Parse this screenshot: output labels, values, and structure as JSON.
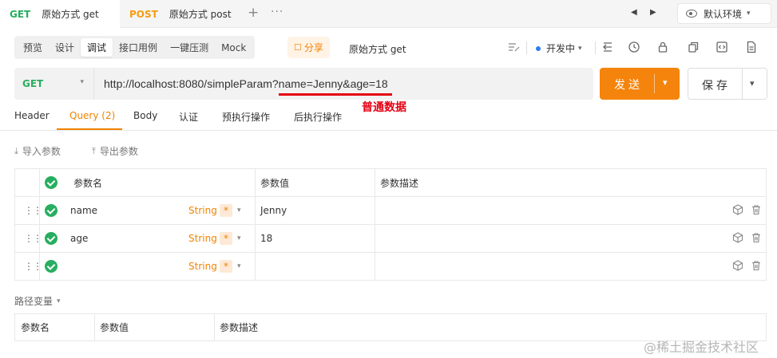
{
  "tabs": [
    {
      "method": "GET",
      "title": "原始方式 get",
      "active": true
    },
    {
      "method": "POST",
      "title": "原始方式 post",
      "active": false
    }
  ],
  "tabbar": {
    "add": "+",
    "more": "···",
    "prev": "◀",
    "next": "▶"
  },
  "env": {
    "label": "默认环境",
    "chevron": "▾"
  },
  "modes": [
    "预览",
    "设计",
    "调试",
    "接口用例",
    "一键压测",
    "Mock"
  ],
  "active_mode": "调试",
  "share": {
    "label": "分享",
    "icon": "share-icon"
  },
  "api_name": "原始方式 get",
  "status": {
    "label": "开发中",
    "color": "#2f7cf6"
  },
  "request": {
    "method": "GET",
    "url": "http://localhost:8080/simpleParam?name=Jenny&age=18",
    "send_label": "发送",
    "save_label": "保存"
  },
  "annotation": "普通数据",
  "request_tabs": [
    {
      "label": "Header"
    },
    {
      "label": "Query",
      "count": "(2)",
      "active": true
    },
    {
      "label": "Body"
    },
    {
      "label": "认证"
    },
    {
      "label": "预执行操作"
    },
    {
      "label": "后执行操作"
    }
  ],
  "actions": {
    "import": "导入参数",
    "export": "导出参数"
  },
  "params_table": {
    "headers": {
      "name": "参数名",
      "value": "参数值",
      "desc": "参数描述"
    },
    "rows": [
      {
        "name": "name",
        "type": "String",
        "required": "*",
        "value": "Jenny",
        "desc": ""
      },
      {
        "name": "age",
        "type": "String",
        "required": "*",
        "value": "18",
        "desc": ""
      },
      {
        "name": "",
        "type": "String",
        "required": "*",
        "value": "",
        "desc": ""
      }
    ]
  },
  "path_vars": {
    "label": "路径变量",
    "headers": {
      "name": "参数名",
      "value": "参数值",
      "desc": "参数描述"
    }
  },
  "watermark": "@稀土掘金技术社区",
  "colors": {
    "accent": "#f08300",
    "get": "#27ae60",
    "post": "#f39c12",
    "send": "#f5840c",
    "annotation": "#e60012"
  }
}
